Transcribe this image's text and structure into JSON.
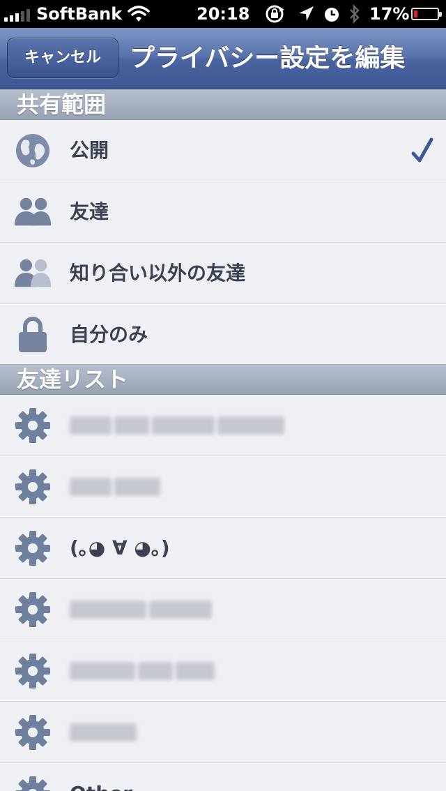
{
  "status_bar": {
    "carrier": "SoftBank",
    "time": "20:18",
    "battery_percent": "17%",
    "battery_level": 0.17,
    "icons": [
      "wifi-icon",
      "rotation-lock-icon",
      "location-arrow-icon",
      "alarm-clock-icon",
      "bluetooth-icon"
    ]
  },
  "nav": {
    "cancel_label": "キャンセル",
    "title": "プライバシー設定を編集"
  },
  "sections": {
    "audience": {
      "header": "共有範囲",
      "items": [
        {
          "label": "公開",
          "icon": "globe-icon",
          "selected": true
        },
        {
          "label": "友達",
          "icon": "friends-icon",
          "selected": false
        },
        {
          "label": "知り合い以外の友達",
          "icon": "friends-except-acquaintances-icon",
          "selected": false
        },
        {
          "label": "自分のみ",
          "icon": "lock-icon",
          "selected": false
        }
      ]
    },
    "friend_lists": {
      "header": "友達リスト",
      "items": [
        {
          "label": "",
          "icon": "gear-icon"
        },
        {
          "label": "",
          "icon": "gear-icon"
        },
        {
          "label": "(｡◕ ∀ ◕｡)",
          "icon": "gear-icon"
        },
        {
          "label": "",
          "icon": "gear-icon"
        },
        {
          "label": "",
          "icon": "gear-icon"
        },
        {
          "label": "",
          "icon": "gear-icon"
        },
        {
          "label": "Other",
          "icon": "gear-icon"
        }
      ]
    }
  },
  "colors": {
    "nav_bar": "#4a64a0",
    "section_header": "#a4aebd",
    "row_background": "#eef0f4",
    "label_text": "#3a4150",
    "icon": "#6f7f9e",
    "checkmark": "#3b5794"
  }
}
